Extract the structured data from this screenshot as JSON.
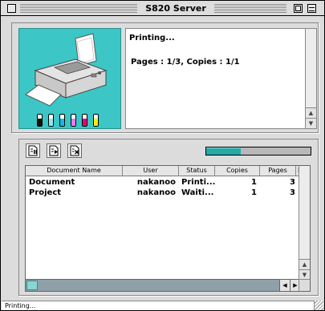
{
  "window": {
    "title": "S820 Server"
  },
  "status": {
    "message": "Printing...",
    "details": "Pages : 1/3, Copies : 1/1"
  },
  "ink_colors": [
    {
      "name": "black",
      "color": "#111111"
    },
    {
      "name": "photo-cyan",
      "color": "#8fe8f0"
    },
    {
      "name": "cyan",
      "color": "#18b7e5"
    },
    {
      "name": "photo-magenta",
      "color": "#ee77ee"
    },
    {
      "name": "magenta",
      "color": "#e5007e"
    },
    {
      "name": "yellow",
      "color": "#ffee00"
    }
  ],
  "toolbar": {
    "buttons": [
      {
        "name": "hold-job-button",
        "icon": "pause-document-icon"
      },
      {
        "name": "resume-job-button",
        "icon": "resume-document-icon"
      },
      {
        "name": "delete-job-button",
        "icon": "delete-document-icon"
      }
    ],
    "progress_fraction": 0.33
  },
  "table": {
    "columns": [
      "Document Name",
      "User",
      "Status",
      "Copies",
      "Pages",
      "Re"
    ],
    "rows": [
      {
        "document": "Document",
        "user": "nakanoo",
        "status": "Printi...",
        "copies": "1",
        "pages": "3"
      },
      {
        "document": "Project",
        "user": "nakanoo",
        "status": "Waiti...",
        "copies": "1",
        "pages": "3"
      }
    ]
  },
  "statusbar": {
    "text": "Printing..."
  },
  "colors": {
    "accent": "#2aa7a7",
    "printer_bg": "#3cc6c6"
  }
}
